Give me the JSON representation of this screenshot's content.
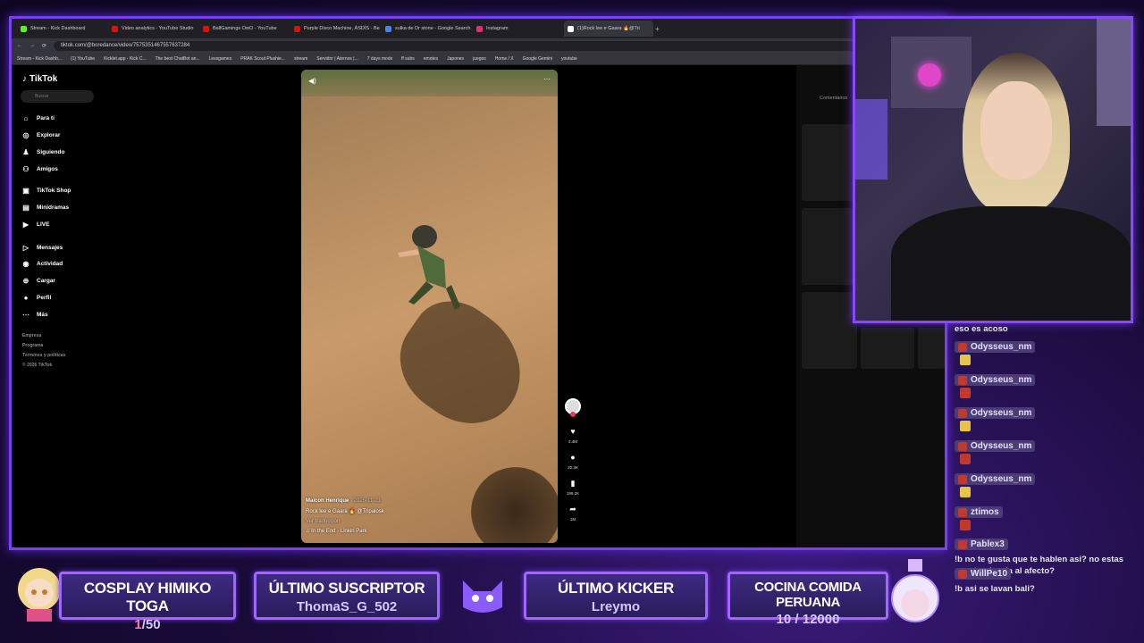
{
  "browser": {
    "tabs": [
      {
        "label": "Stream - Kick Dashboard",
        "color": "#53fc18"
      },
      {
        "label": "Video analytics - YouTube Studio",
        "color": "#ff0000"
      },
      {
        "label": "BallGamings OwO - YouTube",
        "color": "#ff0000"
      },
      {
        "label": "Purple Disco Machine, ÁSDÍS - Beat",
        "color": "#ff0000"
      },
      {
        "label": "sulka de Dr stone - Google Search",
        "color": "#4285f4"
      },
      {
        "label": "Instagram",
        "color": "#e1306c"
      },
      {
        "label": "(1)Rock lee e Gaara 🔥@Tri",
        "color": "#ffffff"
      }
    ],
    "url": "tiktok.com/@boredance/video/7575351467557637284",
    "bookmarks": [
      "Stream - Kick Dashb...",
      "(1) YouTube",
      "Kicklet.app - Kick C...",
      "The best ChatBot an...",
      "Lessgames",
      "PRAK Scout Plushie...",
      "stream",
      "Servidor | Aternos |...",
      "7 days mods",
      "ff subs",
      "emotes",
      "Japones",
      "juegos",
      "Home / X",
      "Google Gemini",
      "youtube"
    ]
  },
  "tiktok": {
    "logo": "TikTok",
    "search_placeholder": "Buscar",
    "nav": [
      {
        "label": "Para ti",
        "icon": "home-icon"
      },
      {
        "label": "Explorar",
        "icon": "compass-icon"
      },
      {
        "label": "Siguiendo",
        "icon": "following-icon"
      },
      {
        "label": "Amigos",
        "icon": "friends-icon"
      },
      {
        "label": "TikTok Shop",
        "icon": "shop-icon"
      },
      {
        "label": "Minidramas",
        "icon": "drama-icon"
      },
      {
        "label": "LIVE",
        "icon": "live-icon"
      },
      {
        "label": "Mensajes",
        "icon": "messages-icon"
      },
      {
        "label": "Actividad",
        "icon": "activity-icon"
      },
      {
        "label": "Cargar",
        "icon": "upload-icon"
      },
      {
        "label": "Perfil",
        "icon": "profile-icon"
      },
      {
        "label": "Más",
        "icon": "more-icon"
      }
    ],
    "footer": [
      "Empresa",
      "Programa",
      "Términos y políticas",
      "© 2026 TikTok"
    ],
    "video": {
      "author": "Maicon Henrique",
      "date": "· 2025-11-21",
      "caption": "Rock lee e Gaara 🔥 @Tripalosk",
      "translate": "Ver traducción",
      "music": "♫ In the End - Linkin Park"
    },
    "actions": [
      {
        "icon": "heart-icon",
        "count": "3.4M"
      },
      {
        "icon": "comment-icon",
        "count": "20.3K"
      },
      {
        "icon": "bookmark-icon",
        "count": "199.2K"
      },
      {
        "icon": "share-icon",
        "count": "1M"
      }
    ],
    "comments_title": "Comentarios"
  },
  "chat": {
    "messages": [
      {
        "user": "",
        "text": "eso es acoso",
        "emote": ""
      },
      {
        "user": "Odysseus_nm",
        "text": "",
        "emote": "yellow"
      },
      {
        "user": "Odysseus_nm",
        "text": "",
        "emote": "red"
      },
      {
        "user": "Odysseus_nm",
        "text": "",
        "emote": "yellow"
      },
      {
        "user": "Odysseus_nm",
        "text": "",
        "emote": "red"
      },
      {
        "user": "Odysseus_nm",
        "text": "",
        "emote": "yellow"
      },
      {
        "user": "ztimos",
        "text": "",
        "emote": "red"
      },
      {
        "user": "Pablex3",
        "text": "!b no te gusta que te hablen asi? no estas acostumbrada al afecto?",
        "emote": ""
      },
      {
        "user": "WillPe10",
        "text": "!b asi se lavan bali?",
        "emote": ""
      }
    ]
  },
  "overlay": {
    "goal_title": "COSPLAY HIMIKO TOGA",
    "goal_current": "1",
    "goal_total": "/50",
    "subscriber_title": "ÚLTIMO SUSCRIPTOR",
    "subscriber_name": "ThomaS_G_502",
    "kicker_title": "ÚLTIMO KICKER",
    "kicker_name": "Lreymo",
    "cocina_title": "COCINA COMIDA PERUANA",
    "cocina_progress": "10 / 12000",
    "accent": "#8a47ff"
  }
}
